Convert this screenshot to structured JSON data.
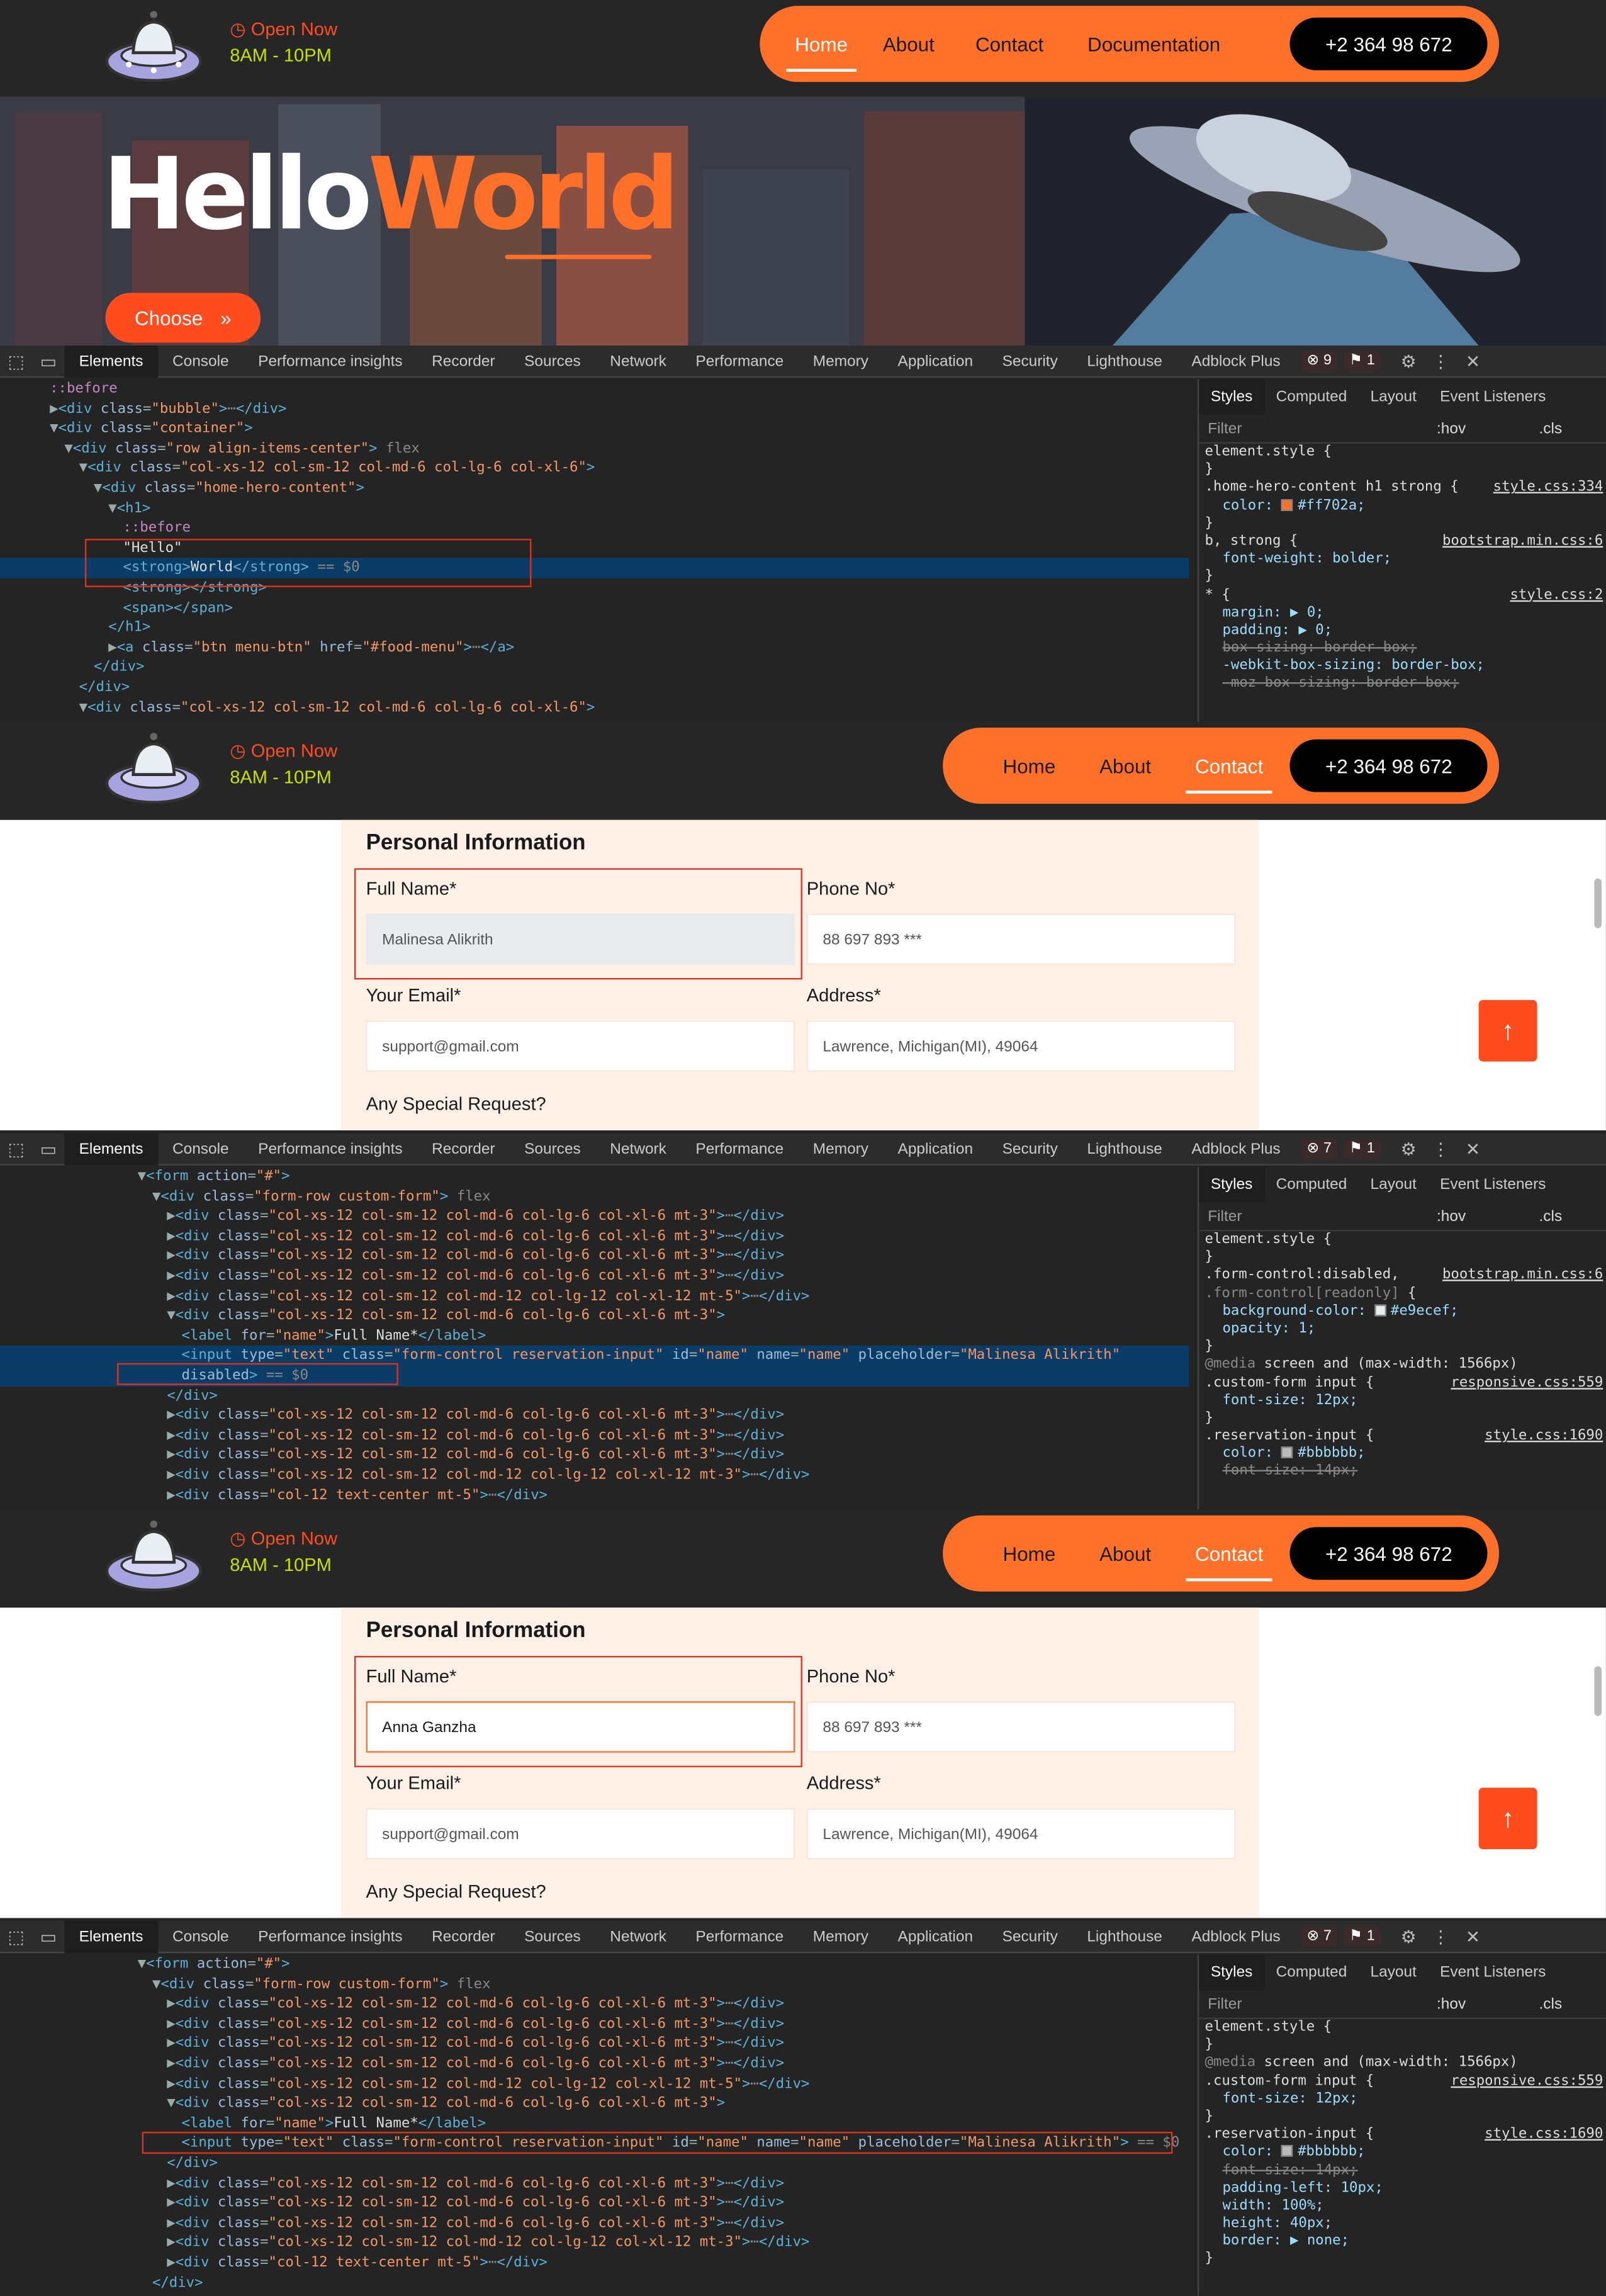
{
  "header": {
    "open_label": "Open Now",
    "hours": "8AM - 10PM",
    "nav1": [
      "Home",
      "About",
      "Contact",
      "Documentation"
    ],
    "nav2": [
      "Home",
      "About",
      "Contact"
    ],
    "phone": "+2 364 98 672"
  },
  "hero": {
    "word1": "Hello",
    "word2": "World",
    "button": "Choose",
    "button_icon": "»"
  },
  "devtools": {
    "tabs": [
      "Elements",
      "Console",
      "Performance insights",
      "Recorder",
      "Sources",
      "Network",
      "Performance",
      "Memory",
      "Application",
      "Security",
      "Lighthouse",
      "Adblock Plus"
    ],
    "panel1": {
      "errors": "9",
      "issues": "1"
    },
    "panel23": {
      "errors": "7",
      "issues": "1"
    },
    "styles_tabs": [
      "Styles",
      "Computed",
      "Layout",
      "Event Listeners"
    ],
    "filter": "Filter",
    "hov": ":hov",
    "cls": ".cls"
  },
  "dom1": [
    {
      "i": 0,
      "h": "<span class='pseudo'>::before</span>"
    },
    {
      "i": 0,
      "h": "▶<span class='tag'>&lt;div </span><span class='att'>class</span>=<span class='val'>\"bubble\"</span><span class='tag'>&gt;</span><span class='dim'>⋯</span><span class='tag'>&lt;/div&gt;</span>"
    },
    {
      "i": 0,
      "h": "▼<span class='tag'>&lt;div </span><span class='att'>class</span>=<span class='val'>\"container\"</span><span class='tag'>&gt;</span>"
    },
    {
      "i": 1,
      "h": "▼<span class='tag'>&lt;div </span><span class='att'>class</span>=<span class='val'>\"row align-items-center\"</span><span class='tag'>&gt;</span> <span class='dim'>flex</span>"
    },
    {
      "i": 2,
      "h": "▼<span class='tag'>&lt;div </span><span class='att'>class</span>=<span class='val'>\"col-xs-12 col-sm-12 col-md-6 col-lg-6 col-xl-6\"</span><span class='tag'>&gt;</span>"
    },
    {
      "i": 3,
      "h": "▼<span class='tag'>&lt;div </span><span class='att'>class</span>=<span class='val'>\"home-hero-content\"</span><span class='tag'>&gt;</span>"
    },
    {
      "i": 4,
      "h": "▼<span class='tag'>&lt;h1&gt;</span>"
    },
    {
      "i": 5,
      "h": "<span class='pseudo'>::before</span>"
    },
    {
      "i": 5,
      "h": "<span class='txt'>\"Hello\"</span>"
    },
    {
      "i": 5,
      "h": "<span class='tag'>&lt;strong&gt;</span><span class='txt'>World</span><span class='tag'>&lt;/strong&gt;</span> <span class='dim'>== $0</span>",
      "sel": true
    },
    {
      "i": 5,
      "h": "<span class='tag'>&lt;strong&gt;&lt;/strong&gt;</span>"
    },
    {
      "i": 5,
      "h": "<span class='tag'>&lt;span&gt;&lt;/span&gt;</span>"
    },
    {
      "i": 4,
      "h": "<span class='tag'>&lt;/h1&gt;</span>"
    },
    {
      "i": 4,
      "h": "▶<span class='tag'>&lt;a </span><span class='att'>class</span>=<span class='val'>\"btn menu-btn\"</span> <span class='att'>href</span>=<span class='val'>\"#food-menu\"</span><span class='tag'>&gt;</span><span class='dim'>⋯</span><span class='tag'>&lt;/a&gt;</span>"
    },
    {
      "i": 3,
      "h": "<span class='tag'>&lt;/div&gt;</span>"
    },
    {
      "i": 2,
      "h": "<span class='tag'>&lt;/div&gt;</span>"
    },
    {
      "i": 2,
      "h": "▼<span class='tag'>&lt;div </span><span class='att'>class</span>=<span class='val'>\"col-xs-12 col-sm-12 col-md-6 col-lg-6 col-xl-6\"</span><span class='tag'>&gt;</span>"
    }
  ],
  "css1": [
    {
      "t": "sel",
      "h": "element.style {"
    },
    {
      "t": "sel",
      "h": "}"
    },
    {
      "t": "sel",
      "h": ".home-hero-content h1 strong {",
      "src": "style.css:334"
    },
    {
      "t": "prop",
      "h": "color: <span class='sw' style='background:#ff702a'></span>#ff702a;"
    },
    {
      "t": "sel",
      "h": "}"
    },
    {
      "t": "sel",
      "h": "b, strong {",
      "src": "bootstrap.min.css:6"
    },
    {
      "t": "prop",
      "h": "font-weight: bolder;"
    },
    {
      "t": "sel",
      "h": "}"
    },
    {
      "t": "sel",
      "h": "* {",
      "src": "style.css:2"
    },
    {
      "t": "prop",
      "h": "margin: ▶ 0;"
    },
    {
      "t": "prop",
      "h": "padding: ▶ 0;"
    },
    {
      "t": "prop",
      "h": "<span class='strike'>box-sizing: border-box;</span>"
    },
    {
      "t": "prop",
      "h": "-webkit-box-sizing: border-box;"
    },
    {
      "t": "prop",
      "h": "<span class='strike'>-moz-box-sizing: border-box;</span>"
    }
  ],
  "dom2": [
    {
      "i": 6,
      "h": "▼<span class='tag'>&lt;form </span><span class='att'>action</span>=<span class='val'>\"#\"</span><span class='tag'>&gt;</span>"
    },
    {
      "i": 7,
      "h": "▼<span class='tag'>&lt;div </span><span class='att'>class</span>=<span class='val'>\"form-row custom-form\"</span><span class='tag'>&gt;</span> <span class='dim'>flex</span>"
    },
    {
      "i": 8,
      "h": "▶<span class='tag'>&lt;div </span><span class='att'>class</span>=<span class='val'>\"col-xs-12 col-sm-12 col-md-6 col-lg-6 col-xl-6 mt-3\"</span><span class='tag'>&gt;</span><span class='dim'>⋯</span><span class='tag'>&lt;/div&gt;</span>"
    },
    {
      "i": 8,
      "h": "▶<span class='tag'>&lt;div </span><span class='att'>class</span>=<span class='val'>\"col-xs-12 col-sm-12 col-md-6 col-lg-6 col-xl-6 mt-3\"</span><span class='tag'>&gt;</span><span class='dim'>⋯</span><span class='tag'>&lt;/div&gt;</span>"
    },
    {
      "i": 8,
      "h": "▶<span class='tag'>&lt;div </span><span class='att'>class</span>=<span class='val'>\"col-xs-12 col-sm-12 col-md-6 col-lg-6 col-xl-6 mt-3\"</span><span class='tag'>&gt;</span><span class='dim'>⋯</span><span class='tag'>&lt;/div&gt;</span>"
    },
    {
      "i": 8,
      "h": "▶<span class='tag'>&lt;div </span><span class='att'>class</span>=<span class='val'>\"col-xs-12 col-sm-12 col-md-6 col-lg-6 col-xl-6 mt-3\"</span><span class='tag'>&gt;</span><span class='dim'>⋯</span><span class='tag'>&lt;/div&gt;</span>"
    },
    {
      "i": 8,
      "h": "▶<span class='tag'>&lt;div </span><span class='att'>class</span>=<span class='val'>\"col-xs-12 col-sm-12 col-md-12 col-lg-12 col-xl-12 mt-5\"</span><span class='tag'>&gt;</span><span class='dim'>⋯</span><span class='tag'>&lt;/div&gt;</span>"
    },
    {
      "i": 8,
      "h": "▼<span class='tag'>&lt;div </span><span class='att'>class</span>=<span class='val'>\"col-xs-12 col-sm-12 col-md-6 col-lg-6 col-xl-6 mt-3\"</span><span class='tag'>&gt;</span>"
    },
    {
      "i": 9,
      "h": "<span class='tag'>&lt;label </span><span class='att'>for</span>=<span class='val'>\"name\"</span><span class='tag'>&gt;</span><span class='txt'>Full Name*</span><span class='tag'>&lt;/label&gt;</span>"
    },
    {
      "i": 9,
      "h": "<span class='tag'>&lt;input </span><span class='att'>type</span>=<span class='val'>\"text\"</span> <span class='att'>class</span>=<span class='val'>\"form-control reservation-input\"</span> <span class='att'>id</span>=<span class='val'>\"name\"</span> <span class='att'>name</span>=<span class='val'>\"name\"</span> <span class='att'>placeholder</span>=<span class='val'>\"Malinesa Alikrith\"</span>",
      "sel": true
    },
    {
      "i": 9,
      "h": "<span class='att'>disabled</span><span class='tag'>&gt;</span> <span class='dim'>== $0</span>",
      "sel": true
    },
    {
      "i": 8,
      "h": "<span class='tag'>&lt;/div&gt;</span>"
    },
    {
      "i": 8,
      "h": "▶<span class='tag'>&lt;div </span><span class='att'>class</span>=<span class='val'>\"col-xs-12 col-sm-12 col-md-6 col-lg-6 col-xl-6 mt-3\"</span><span class='tag'>&gt;</span><span class='dim'>⋯</span><span class='tag'>&lt;/div&gt;</span>"
    },
    {
      "i": 8,
      "h": "▶<span class='tag'>&lt;div </span><span class='att'>class</span>=<span class='val'>\"col-xs-12 col-sm-12 col-md-6 col-lg-6 col-xl-6 mt-3\"</span><span class='tag'>&gt;</span><span class='dim'>⋯</span><span class='tag'>&lt;/div&gt;</span>"
    },
    {
      "i": 8,
      "h": "▶<span class='tag'>&lt;div </span><span class='att'>class</span>=<span class='val'>\"col-xs-12 col-sm-12 col-md-6 col-lg-6 col-xl-6 mt-3\"</span><span class='tag'>&gt;</span><span class='dim'>⋯</span><span class='tag'>&lt;/div&gt;</span>"
    },
    {
      "i": 8,
      "h": "▶<span class='tag'>&lt;div </span><span class='att'>class</span>=<span class='val'>\"col-xs-12 col-sm-12 col-md-12 col-lg-12 col-xl-12 mt-3\"</span><span class='tag'>&gt;</span><span class='dim'>⋯</span><span class='tag'>&lt;/div&gt;</span>"
    },
    {
      "i": 8,
      "h": "▶<span class='tag'>&lt;div </span><span class='att'>class</span>=<span class='val'>\"col-12 text-center mt-5\"</span><span class='tag'>&gt;</span><span class='dim'>⋯</span><span class='tag'>&lt;/div&gt;</span>"
    }
  ],
  "css2": [
    {
      "t": "sel",
      "h": "element.style {"
    },
    {
      "t": "sel",
      "h": "}"
    },
    {
      "t": "sel",
      "h": ".form-control:disabled,",
      "src": "bootstrap.min.css:6"
    },
    {
      "t": "sel",
      "h": "<span class='dim'>.form-control[readonly]</span> {"
    },
    {
      "t": "prop",
      "h": "background-color: <span class='sw' style='background:#e9ecef'></span>#e9ecef;"
    },
    {
      "t": "prop",
      "h": "opacity: 1;"
    },
    {
      "t": "sel",
      "h": "}"
    },
    {
      "t": "sel",
      "h": "<span class='dim'>@media</span> screen and (max-width: 1566px)"
    },
    {
      "t": "sel",
      "h": ".custom-form input {",
      "src": "responsive.css:559"
    },
    {
      "t": "prop",
      "h": "font-size: 12px;"
    },
    {
      "t": "sel",
      "h": "}"
    },
    {
      "t": "sel",
      "h": ".reservation-input {",
      "src": "style.css:1690"
    },
    {
      "t": "prop",
      "h": "color: <span class='sw' style='background:#bbbbbb'></span>#bbbbbb;"
    },
    {
      "t": "prop",
      "h": "<span class='strike'>font-size: 14px;</span>"
    }
  ],
  "dom3": [
    {
      "i": 6,
      "h": "▼<span class='tag'>&lt;form </span><span class='att'>action</span>=<span class='val'>\"#\"</span><span class='tag'>&gt;</span>"
    },
    {
      "i": 7,
      "h": "▼<span class='tag'>&lt;div </span><span class='att'>class</span>=<span class='val'>\"form-row custom-form\"</span><span class='tag'>&gt;</span> <span class='dim'>flex</span>"
    },
    {
      "i": 8,
      "h": "▶<span class='tag'>&lt;div </span><span class='att'>class</span>=<span class='val'>\"col-xs-12 col-sm-12 col-md-6 col-lg-6 col-xl-6 mt-3\"</span><span class='tag'>&gt;</span><span class='dim'>⋯</span><span class='tag'>&lt;/div&gt;</span>"
    },
    {
      "i": 8,
      "h": "▶<span class='tag'>&lt;div </span><span class='att'>class</span>=<span class='val'>\"col-xs-12 col-sm-12 col-md-6 col-lg-6 col-xl-6 mt-3\"</span><span class='tag'>&gt;</span><span class='dim'>⋯</span><span class='tag'>&lt;/div&gt;</span>"
    },
    {
      "i": 8,
      "h": "▶<span class='tag'>&lt;div </span><span class='att'>class</span>=<span class='val'>\"col-xs-12 col-sm-12 col-md-6 col-lg-6 col-xl-6 mt-3\"</span><span class='tag'>&gt;</span><span class='dim'>⋯</span><span class='tag'>&lt;/div&gt;</span>"
    },
    {
      "i": 8,
      "h": "▶<span class='tag'>&lt;div </span><span class='att'>class</span>=<span class='val'>\"col-xs-12 col-sm-12 col-md-6 col-lg-6 col-xl-6 mt-3\"</span><span class='tag'>&gt;</span><span class='dim'>⋯</span><span class='tag'>&lt;/div&gt;</span>"
    },
    {
      "i": 8,
      "h": "▶<span class='tag'>&lt;div </span><span class='att'>class</span>=<span class='val'>\"col-xs-12 col-sm-12 col-md-12 col-lg-12 col-xl-12 mt-5\"</span><span class='tag'>&gt;</span><span class='dim'>⋯</span><span class='tag'>&lt;/div&gt;</span>"
    },
    {
      "i": 8,
      "h": "▼<span class='tag'>&lt;div </span><span class='att'>class</span>=<span class='val'>\"col-xs-12 col-sm-12 col-md-6 col-lg-6 col-xl-6 mt-3\"</span><span class='tag'>&gt;</span>"
    },
    {
      "i": 9,
      "h": "<span class='tag'>&lt;label </span><span class='att'>for</span>=<span class='val'>\"name\"</span><span class='tag'>&gt;</span><span class='txt'>Full Name*</span><span class='tag'>&lt;/label&gt;</span>"
    },
    {
      "i": 9,
      "h": "<span class='tag'>&lt;input </span><span class='att'>type</span>=<span class='val'>\"text\"</span> <span class='att'>class</span>=<span class='val'>\"form-control reservation-input\"</span> <span class='att'>id</span>=<span class='val'>\"name\"</span> <span class='att'>name</span>=<span class='val'>\"name\"</span> <span class='att'>placeholder</span>=<span class='val'>\"Malinesa Alikrith\"</span><span class='tag'>&gt;</span> <span class='dim'>== $0</span>",
      "hl": true
    },
    {
      "i": 8,
      "h": "<span class='tag'>&lt;/div&gt;</span>"
    },
    {
      "i": 8,
      "h": "▶<span class='tag'>&lt;div </span><span class='att'>class</span>=<span class='val'>\"col-xs-12 col-sm-12 col-md-6 col-lg-6 col-xl-6 mt-3\"</span><span class='tag'>&gt;</span><span class='dim'>⋯</span><span class='tag'>&lt;/div&gt;</span>"
    },
    {
      "i": 8,
      "h": "▶<span class='tag'>&lt;div </span><span class='att'>class</span>=<span class='val'>\"col-xs-12 col-sm-12 col-md-6 col-lg-6 col-xl-6 mt-3\"</span><span class='tag'>&gt;</span><span class='dim'>⋯</span><span class='tag'>&lt;/div&gt;</span>"
    },
    {
      "i": 8,
      "h": "▶<span class='tag'>&lt;div </span><span class='att'>class</span>=<span class='val'>\"col-xs-12 col-sm-12 col-md-6 col-lg-6 col-xl-6 mt-3\"</span><span class='tag'>&gt;</span><span class='dim'>⋯</span><span class='tag'>&lt;/div&gt;</span>"
    },
    {
      "i": 8,
      "h": "▶<span class='tag'>&lt;div </span><span class='att'>class</span>=<span class='val'>\"col-xs-12 col-sm-12 col-md-12 col-lg-12 col-xl-12 mt-3\"</span><span class='tag'>&gt;</span><span class='dim'>⋯</span><span class='tag'>&lt;/div&gt;</span>"
    },
    {
      "i": 8,
      "h": "▶<span class='tag'>&lt;div </span><span class='att'>class</span>=<span class='val'>\"col-12 text-center mt-5\"</span><span class='tag'>&gt;</span><span class='dim'>⋯</span><span class='tag'>&lt;/div&gt;</span>"
    },
    {
      "i": 7,
      "h": "<span class='tag'>&lt;/div&gt;</span>"
    }
  ],
  "css3": [
    {
      "t": "sel",
      "h": "element.style {"
    },
    {
      "t": "sel",
      "h": "}"
    },
    {
      "t": "sel",
      "h": "<span class='dim'>@media</span> screen and (max-width: 1566px)"
    },
    {
      "t": "sel",
      "h": ".custom-form input {",
      "src": "responsive.css:559"
    },
    {
      "t": "prop",
      "h": "font-size: 12px;"
    },
    {
      "t": "sel",
      "h": "}"
    },
    {
      "t": "sel",
      "h": ".reservation-input {",
      "src": "style.css:1690"
    },
    {
      "t": "prop",
      "h": "color: <span class='sw' style='background:#bbbbbb'></span>#bbbbbb;"
    },
    {
      "t": "prop",
      "h": "<span class='strike'>font-size: 14px;</span>"
    },
    {
      "t": "prop",
      "h": "padding-left: 10px;"
    },
    {
      "t": "prop",
      "h": "width: 100%;"
    },
    {
      "t": "prop",
      "h": "height: 40px;"
    },
    {
      "t": "prop",
      "h": "border: ▶ none;"
    },
    {
      "t": "sel",
      "h": "}"
    }
  ],
  "form": {
    "title": "Personal Information",
    "name_label": "Full Name*",
    "phone_label": "Phone No*",
    "email_label": "Your Email*",
    "address_label": "Address*",
    "special_label": "Any Special Request?",
    "name_placeholder": "Malinesa Alikrith",
    "name_value": "Anna Ganzha",
    "phone_placeholder": "88 697 893 ***",
    "email_placeholder": "support@gmail.com",
    "address_placeholder": "Lawrence, Michigan(MI), 49064",
    "to_top": "↑"
  }
}
